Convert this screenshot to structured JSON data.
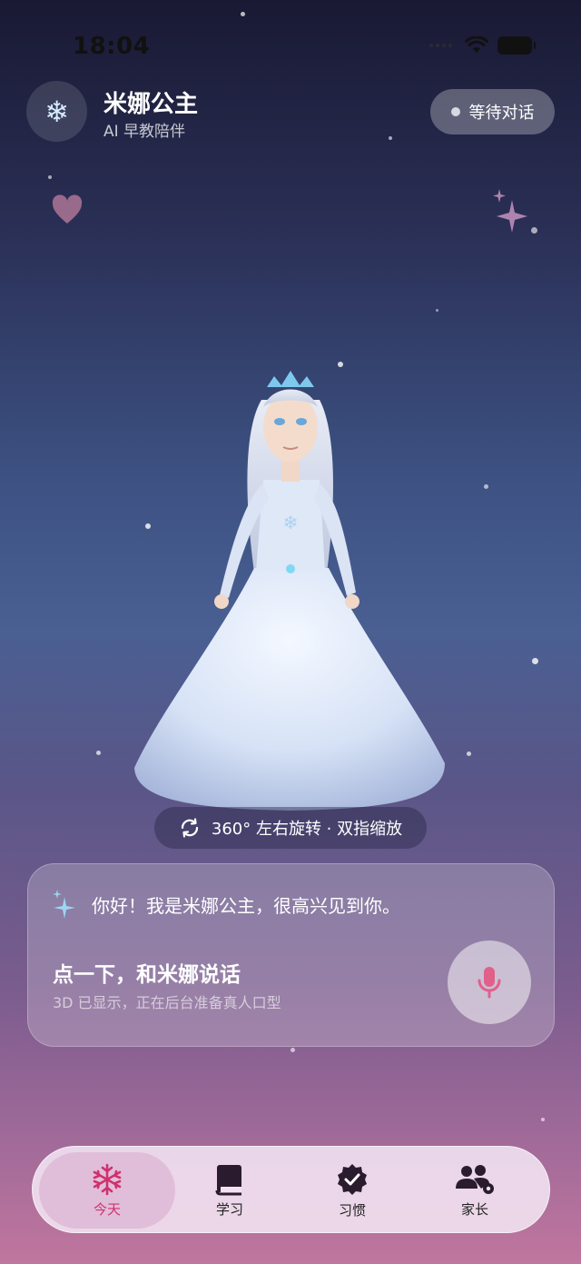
{
  "status_bar": {
    "time": "18:04"
  },
  "header": {
    "title": "米娜公主",
    "subtitle": "AI 早教陪伴",
    "status": "等待对话"
  },
  "viewer": {
    "hint": "360° 左右旋转 · 双指缩放"
  },
  "chat": {
    "greeting": "你好！我是米娜公主，很高兴见到你。",
    "cta_title": "点一下，和米娜说话",
    "cta_subtitle": "3D 已显示，正在后台准备真人口型"
  },
  "tabs": [
    {
      "label": "今天",
      "icon": "snowflake-icon",
      "active": true
    },
    {
      "label": "学习",
      "icon": "book-icon",
      "active": false
    },
    {
      "label": "习惯",
      "icon": "check-badge-icon",
      "active": false
    },
    {
      "label": "家长",
      "icon": "parents-gear-icon",
      "active": false
    }
  ],
  "colors": {
    "accent": "#d0316d",
    "mic": "#e0608a"
  }
}
